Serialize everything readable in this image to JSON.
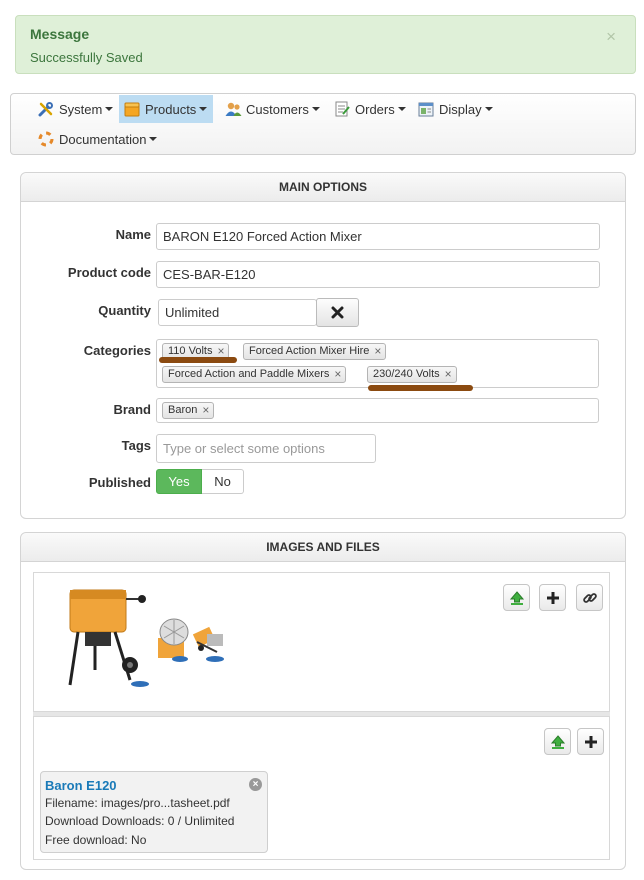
{
  "alert": {
    "title": "Message",
    "message": "Successfully Saved",
    "close_glyph": "×"
  },
  "menu": [
    {
      "label": "System",
      "icon": "tools-icon",
      "active": false
    },
    {
      "label": "Products",
      "icon": "box-icon",
      "active": true
    },
    {
      "label": "Customers",
      "icon": "users-icon",
      "active": false
    },
    {
      "label": "Orders",
      "icon": "orders-icon",
      "active": false
    },
    {
      "label": "Display",
      "icon": "display-icon",
      "active": false
    },
    {
      "label": "Documentation",
      "icon": "help-icon",
      "active": false
    }
  ],
  "main_options": {
    "header": "MAIN OPTIONS",
    "name_label": "Name",
    "name_value": "BARON E120 Forced Action Mixer",
    "code_label": "Product code",
    "code_value": "CES-BAR-E120",
    "quantity_label": "Quantity",
    "quantity_value": "Unlimited",
    "categories_label": "Categories",
    "categories": [
      "110 Volts",
      "Forced Action Mixer Hire",
      "Forced Action and Paddle Mixers",
      "230/240 Volts"
    ],
    "brand_label": "Brand",
    "brand_tags": [
      "Baron"
    ],
    "tags_label": "Tags",
    "tags_placeholder": "Type or select some options",
    "published_label": "Published",
    "published_yes": "Yes",
    "published_no": "No",
    "tag_remove_glyph": "×"
  },
  "images_files": {
    "header": "IMAGES AND FILES",
    "file": {
      "title": "Baron E120",
      "filename": "Filename: images/pro...tasheet.pdf",
      "downloads": "Download Downloads: 0 / Unlimited",
      "free": "Free download: No"
    }
  },
  "colors": {
    "success_bg": "#dff0d8",
    "success_text": "#3c763d",
    "active_menu": "#bcdcf2",
    "yes_button": "#5cb85c",
    "link": "#1a7ab8",
    "annotation_underline": "#8b4a10"
  }
}
